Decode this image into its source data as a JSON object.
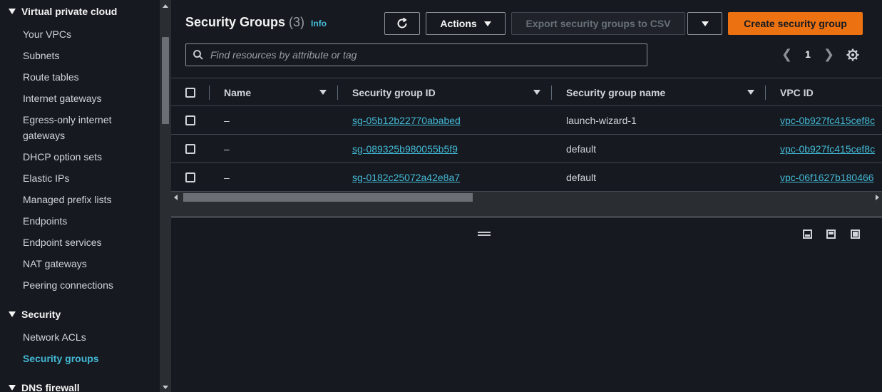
{
  "sidebar": {
    "section_vpc": "Virtual private cloud",
    "vpc_items": [
      "Your VPCs",
      "Subnets",
      "Route tables",
      "Internet gateways",
      "Egress-only internet gateways",
      "DHCP option sets",
      "Elastic IPs",
      "Managed prefix lists",
      "Endpoints",
      "Endpoint services",
      "NAT gateways",
      "Peering connections"
    ],
    "section_security": "Security",
    "security_items": [
      "Network ACLs",
      "Security groups"
    ],
    "active_item": "Security groups",
    "section_dns": "DNS firewall"
  },
  "header": {
    "title": "Security Groups",
    "count": "(3)",
    "info": "Info",
    "actions_label": "Actions",
    "export_label": "Export security groups to CSV",
    "create_label": "Create security group"
  },
  "search": {
    "placeholder": "Find resources by attribute or tag"
  },
  "pagination": {
    "current_page": "1"
  },
  "table": {
    "columns": [
      "Name",
      "Security group ID",
      "Security group name",
      "VPC ID"
    ],
    "rows": [
      {
        "name": "–",
        "group_id": "sg-05b12b22770ababed",
        "group_name": "launch-wizard-1",
        "vpc_id": "vpc-0b927fc415cef8c"
      },
      {
        "name": "–",
        "group_id": "sg-089325b980055b5f9",
        "group_name": "default",
        "vpc_id": "vpc-0b927fc415cef8c"
      },
      {
        "name": "–",
        "group_id": "sg-0182c25072a42e8a7",
        "group_name": "default",
        "vpc_id": "vpc-06f1627b180466"
      }
    ]
  },
  "colors": {
    "accent_link": "#44b9d6",
    "primary_button": "#ec7211",
    "background": "#16191f"
  }
}
